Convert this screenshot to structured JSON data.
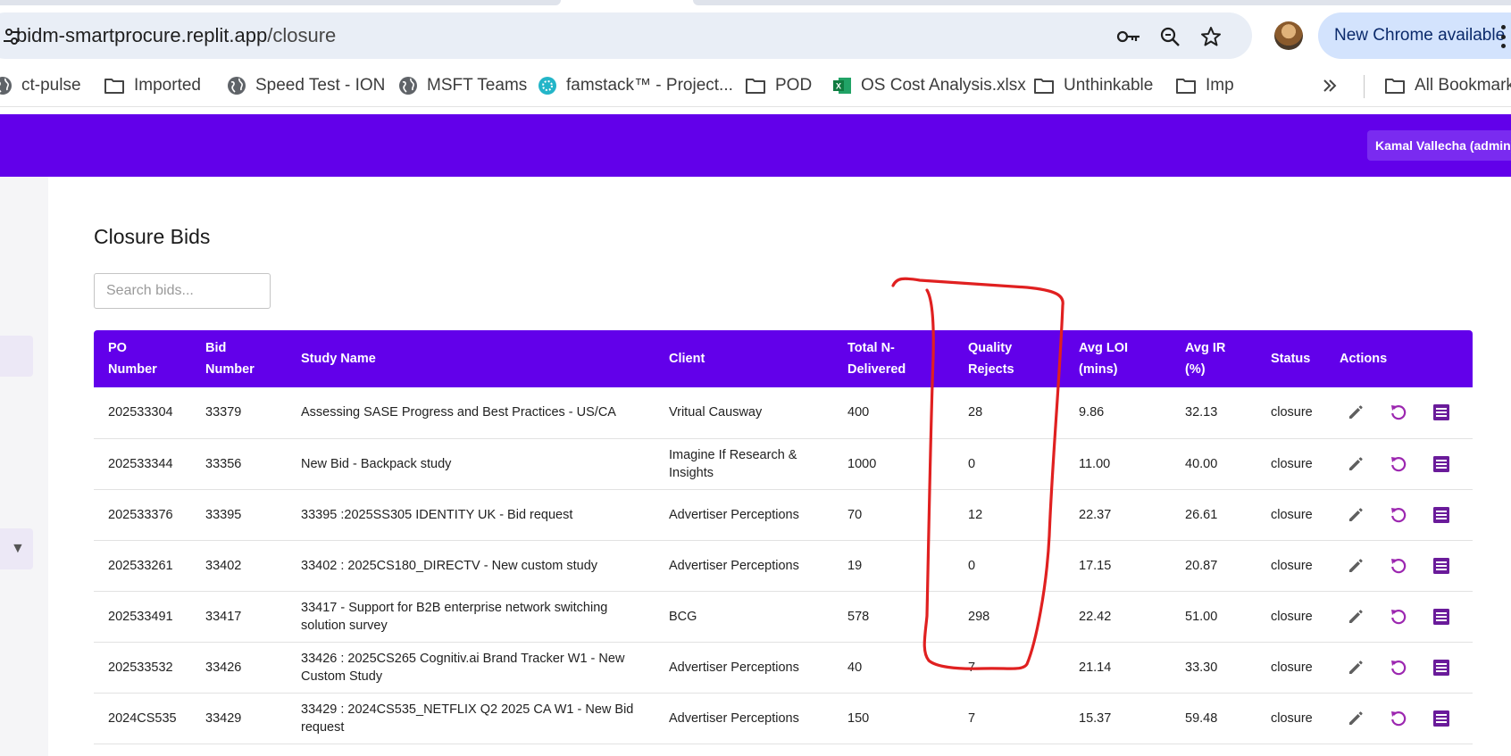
{
  "browser": {
    "url_host": "bidm-smartprocure.replit.app",
    "url_path": "/closure",
    "chrome_update_label": "New Chrome available",
    "bookmarks": [
      {
        "label": "ct-pulse",
        "icon": "globe-icon"
      },
      {
        "label": "Imported",
        "icon": "folder-icon"
      },
      {
        "label": "Speed Test - ION",
        "icon": "globe-icon"
      },
      {
        "label": "MSFT Teams",
        "icon": "globe-icon"
      },
      {
        "label": "famstack™ - Project...",
        "icon": "famstack-icon"
      },
      {
        "label": "POD",
        "icon": "folder-icon"
      },
      {
        "label": "OS Cost Analysis.xlsx",
        "icon": "excel-icon"
      },
      {
        "label": "Unthinkable",
        "icon": "folder-icon"
      },
      {
        "label": "Imp",
        "icon": "folder-icon"
      },
      {
        "label": "All Bookmarks",
        "icon": "folder-icon"
      }
    ]
  },
  "app": {
    "user_label": "Kamal Vallecha (admin)",
    "page_title": "Closure Bids",
    "search_placeholder": "Search bids...",
    "colors": {
      "primary": "#6200ea",
      "annotation": "#e02020"
    }
  },
  "table": {
    "headers": {
      "po": [
        "PO",
        "Number"
      ],
      "bid": [
        "Bid",
        "Number"
      ],
      "study": [
        "Study Name"
      ],
      "client": [
        "Client"
      ],
      "total": [
        "Total N-",
        "Delivered"
      ],
      "rejects": [
        "Quality",
        "Rejects"
      ],
      "loi": [
        "Avg LOI",
        "(mins)"
      ],
      "ir": [
        "Avg IR",
        "(%)"
      ],
      "status": [
        "Status"
      ],
      "actions": [
        "Actions"
      ]
    },
    "rows": [
      {
        "po": "202533304",
        "bid": "33379",
        "study": "Assessing SASE Progress and Best Practices - US/CA",
        "client": "Vritual Causway",
        "total": "400",
        "rejects": "28",
        "loi": "9.86",
        "ir": "32.13",
        "status": "closure"
      },
      {
        "po": "202533344",
        "bid": "33356",
        "study": "New Bid - Backpack study",
        "client": "Imagine If Research & Insights",
        "total": "1000",
        "rejects": "0",
        "loi": "11.00",
        "ir": "40.00",
        "status": "closure"
      },
      {
        "po": "202533376",
        "bid": "33395",
        "study": "33395 :2025SS305 IDENTITY UK - Bid request",
        "client": "Advertiser Perceptions",
        "total": "70",
        "rejects": "12",
        "loi": "22.37",
        "ir": "26.61",
        "status": "closure"
      },
      {
        "po": "202533261",
        "bid": "33402",
        "study": "33402 : 2025CS180_DIRECTV - New custom study",
        "client": "Advertiser Perceptions",
        "total": "19",
        "rejects": "0",
        "loi": "17.15",
        "ir": "20.87",
        "status": "closure"
      },
      {
        "po": "202533491",
        "bid": "33417",
        "study": "33417 - Support for B2B enterprise network switching solution survey",
        "client": "BCG",
        "total": "578",
        "rejects": "298",
        "loi": "22.42",
        "ir": "51.00",
        "status": "closure"
      },
      {
        "po": "202533532",
        "bid": "33426",
        "study": "33426 : 2025CS265 Cognitiv.ai Brand Tracker W1 - New Custom Study",
        "client": "Advertiser Perceptions",
        "total": "40",
        "rejects": "7",
        "loi": "21.14",
        "ir": "33.30",
        "status": "closure"
      },
      {
        "po": "2024CS535",
        "bid": "33429",
        "study": "33429 : 2024CS535_NETFLIX Q2 2025 CA W1 - New Bid request",
        "client": "Advertiser Perceptions",
        "total": "150",
        "rejects": "7",
        "loi": "15.37",
        "ir": "59.48",
        "status": "closure"
      }
    ]
  }
}
